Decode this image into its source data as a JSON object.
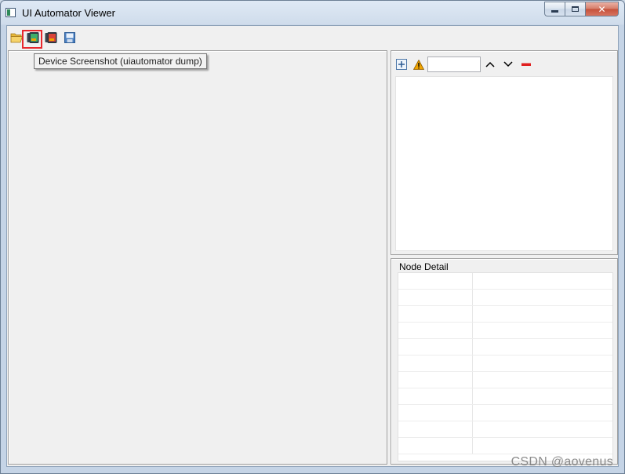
{
  "window": {
    "title": "UI Automator Viewer",
    "close_glyph": "✕"
  },
  "toolbar": {
    "buttons": [
      {
        "name": "open-folder-icon"
      },
      {
        "name": "device-screenshot-icon"
      },
      {
        "name": "device-screenshot-compressed-icon"
      },
      {
        "name": "save-icon"
      }
    ],
    "tooltip": "Device Screenshot (uiautomator dump)"
  },
  "tree_toolbar": {
    "search_value": ""
  },
  "node_detail": {
    "label": "Node Detail",
    "rows": 11
  },
  "watermark": "CSDN @aovenus",
  "colors": {
    "highlight": "#e8262c",
    "remove": "#e02020",
    "warning": "#f0a400"
  }
}
